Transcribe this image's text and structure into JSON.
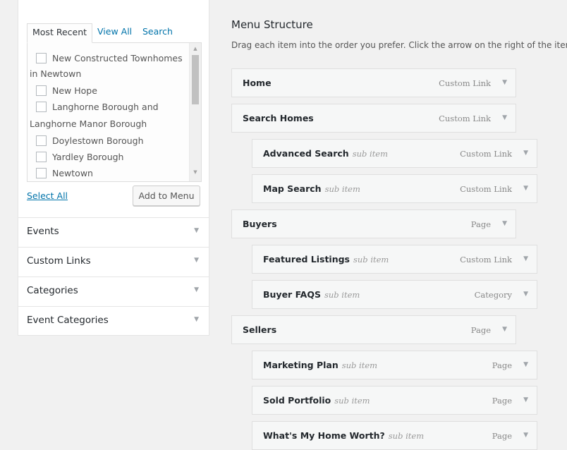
{
  "left": {
    "tabs": [
      "Most Recent",
      "View All",
      "Search"
    ],
    "items": [
      {
        "line1": "New Constructed Townhomes",
        "line2": "in Newtown"
      },
      {
        "line1": "New Hope",
        "line2": ""
      },
      {
        "line1": "Langhorne Borough and",
        "line2": "Langhorne Manor Borough"
      },
      {
        "line1": "Doylestown Borough",
        "line2": ""
      },
      {
        "line1": "Yardley Borough",
        "line2": ""
      },
      {
        "line1": "Newtown",
        "line2": ""
      }
    ],
    "select_all": "Select All",
    "add_to_menu": "Add to Menu",
    "sections": [
      "Events",
      "Custom Links",
      "Categories",
      "Event Categories"
    ]
  },
  "menu": {
    "title": "Menu Structure",
    "description": "Drag each item into the order you prefer. Click the arrow on the right of the item",
    "items": [
      {
        "title": "Home",
        "sub": "",
        "type": "Custom Link"
      },
      {
        "title": "Search Homes",
        "sub": "",
        "type": "Custom Link"
      },
      {
        "title": "Advanced Search",
        "sub": "sub item",
        "type": "Custom Link"
      },
      {
        "title": "Map Search",
        "sub": "sub item",
        "type": "Custom Link"
      },
      {
        "title": "Buyers",
        "sub": "",
        "type": "Page"
      },
      {
        "title": "Featured Listings",
        "sub": "sub item",
        "type": "Custom Link"
      },
      {
        "title": "Buyer FAQS",
        "sub": "sub item",
        "type": "Category"
      },
      {
        "title": "Sellers",
        "sub": "",
        "type": "Page"
      },
      {
        "title": "Marketing Plan",
        "sub": "sub item",
        "type": "Page"
      },
      {
        "title": "Sold Portfolio",
        "sub": "sub item",
        "type": "Page"
      },
      {
        "title": "What's My Home Worth?",
        "sub": "sub item",
        "type": "Page"
      }
    ]
  },
  "icons": {
    "expand": "triangle-down-icon",
    "scroll_up": "scroll-up-icon",
    "scroll_down": "scroll-down-icon"
  }
}
